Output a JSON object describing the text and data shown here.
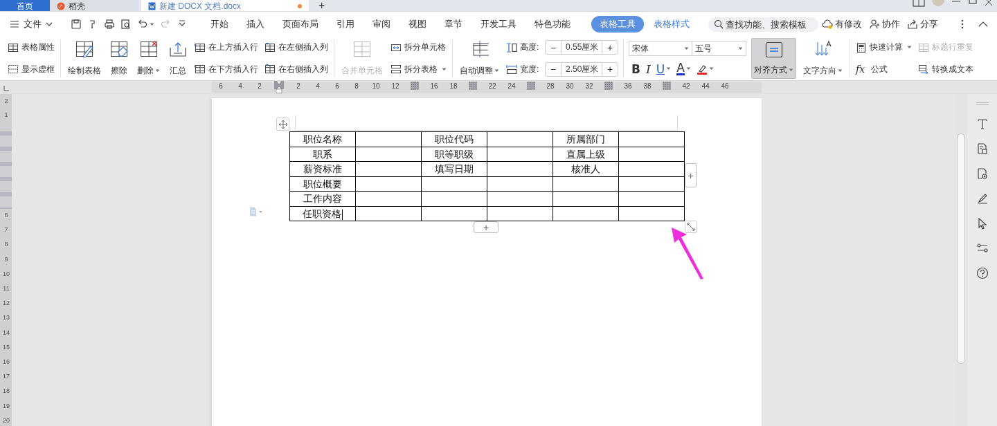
{
  "app_tabs": [
    {
      "label": "首页",
      "kind": "home",
      "selected": false,
      "modified": false
    },
    {
      "label": "稻壳",
      "kind": "docer",
      "selected": false,
      "modified": false
    },
    {
      "label": "新建 DOCX 文档.docx",
      "kind": "document",
      "selected": true,
      "modified": true
    }
  ],
  "new_tab_button": "+",
  "menu_bar": {
    "file_menu": "文件",
    "tabs": [
      {
        "label": "开始",
        "selected": false,
        "contextual": false
      },
      {
        "label": "插入",
        "selected": false,
        "contextual": false
      },
      {
        "label": "页面布局",
        "selected": false,
        "contextual": false
      },
      {
        "label": "引用",
        "selected": false,
        "contextual": false
      },
      {
        "label": "审阅",
        "selected": false,
        "contextual": false
      },
      {
        "label": "视图",
        "selected": false,
        "contextual": false
      },
      {
        "label": "章节",
        "selected": false,
        "contextual": false
      },
      {
        "label": "开发工具",
        "selected": false,
        "contextual": false
      },
      {
        "label": "特色功能",
        "selected": false,
        "contextual": false
      },
      {
        "label": "表格工具",
        "selected": true,
        "contextual": true
      },
      {
        "label": "表格样式",
        "selected": false,
        "contextual": true
      }
    ],
    "search": {
      "placeholder": "查找功能、搜索模板"
    },
    "actions": [
      {
        "label": "有修改"
      },
      {
        "label": "协作"
      },
      {
        "label": "分享"
      }
    ]
  },
  "ribbon": [
    {
      "kind": "stack",
      "items": [
        {
          "label": "表格属性",
          "disabled": false,
          "dropdown": false
        },
        {
          "label": "显示虚框",
          "disabled": false,
          "dropdown": false
        }
      ]
    },
    {
      "kind": "separator"
    },
    {
      "kind": "large",
      "label": "绘制表格",
      "disabled": false,
      "dropdown": false,
      "selected": false
    },
    {
      "kind": "large",
      "label": "擦除",
      "disabled": false,
      "dropdown": false,
      "selected": false
    },
    {
      "kind": "large",
      "label": "删除",
      "disabled": false,
      "dropdown": true,
      "selected": false
    },
    {
      "kind": "large",
      "label": "汇总",
      "disabled": false,
      "dropdown": false,
      "selected": false
    },
    {
      "kind": "stack",
      "items": [
        {
          "label": "在上方插入行",
          "disabled": false,
          "dropdown": false
        },
        {
          "label": "在下方插入行",
          "disabled": false,
          "dropdown": false
        }
      ]
    },
    {
      "kind": "stack",
      "items": [
        {
          "label": "在左侧插入列",
          "disabled": false,
          "dropdown": false
        },
        {
          "label": "在右侧插入列",
          "disabled": false,
          "dropdown": false
        }
      ]
    },
    {
      "kind": "separator"
    },
    {
      "kind": "large",
      "label": "合并单元格",
      "disabled": true,
      "dropdown": false,
      "selected": false
    },
    {
      "kind": "stack",
      "items": [
        {
          "label": "拆分单元格",
          "disabled": false,
          "dropdown": false
        },
        {
          "label": "拆分表格",
          "disabled": false,
          "dropdown": true
        }
      ]
    },
    {
      "kind": "separator"
    },
    {
      "kind": "large",
      "label": "自动调整",
      "disabled": false,
      "dropdown": true,
      "selected": false
    },
    {
      "kind": "spinners",
      "items": [
        {
          "label": "高度:",
          "value": "0.55厘米",
          "minus": "−",
          "plus": "+"
        },
        {
          "label": "宽度:",
          "value": "2.50厘米",
          "minus": "−",
          "plus": "+"
        }
      ]
    },
    {
      "kind": "separator"
    },
    {
      "kind": "font",
      "font": "宋体",
      "size": "五号",
      "buttons": [
        {
          "kind": "bold",
          "label": "B",
          "dropdown": false
        },
        {
          "kind": "italic",
          "label": "I",
          "dropdown": false
        },
        {
          "kind": "underline",
          "label": "U",
          "dropdown": true
        },
        {
          "kind": "font-color",
          "label": "A",
          "dropdown": true,
          "color": "#1a2fc8"
        },
        {
          "kind": "highlight",
          "dropdown": true,
          "color": "#e02828"
        }
      ]
    },
    {
      "kind": "large",
      "label": "对齐方式",
      "disabled": false,
      "dropdown": true,
      "selected": true
    },
    {
      "kind": "large",
      "label": "文字方向",
      "disabled": false,
      "dropdown": true,
      "selected": false
    },
    {
      "kind": "separator"
    },
    {
      "kind": "stack",
      "items": [
        {
          "label": "快速计算",
          "disabled": false,
          "dropdown": true
        },
        {
          "label": "公式",
          "prefix": "fx",
          "disabled": false,
          "dropdown": false
        }
      ]
    },
    {
      "kind": "stack",
      "items": [
        {
          "label": "标题行重复",
          "disabled": true,
          "dropdown": false
        },
        {
          "label": "转换成文本",
          "disabled": false,
          "dropdown": false
        }
      ]
    }
  ],
  "ruler": [
    {
      "kind": "number",
      "label": "6"
    },
    {
      "kind": "number",
      "label": "4"
    },
    {
      "kind": "number",
      "label": "2"
    },
    {
      "kind": "indent"
    },
    {
      "kind": "number",
      "label": "2"
    },
    {
      "kind": "number",
      "label": "4"
    },
    {
      "kind": "number",
      "label": "6"
    },
    {
      "kind": "number",
      "label": "8"
    },
    {
      "kind": "number",
      "label": "10"
    },
    {
      "kind": "number",
      "label": "12"
    },
    {
      "kind": "marker"
    },
    {
      "kind": "number",
      "label": "16"
    },
    {
      "kind": "number",
      "label": "18"
    },
    {
      "kind": "marker"
    },
    {
      "kind": "number",
      "label": "22"
    },
    {
      "kind": "number",
      "label": "24"
    },
    {
      "kind": "marker"
    },
    {
      "kind": "number",
      "label": "28"
    },
    {
      "kind": "number",
      "label": "30"
    },
    {
      "kind": "number",
      "label": "32"
    },
    {
      "kind": "marker"
    },
    {
      "kind": "number",
      "label": "36"
    },
    {
      "kind": "number",
      "label": "38"
    },
    {
      "kind": "marker"
    },
    {
      "kind": "number",
      "label": "42"
    },
    {
      "kind": "number",
      "label": "44"
    },
    {
      "kind": "number",
      "label": "46"
    }
  ],
  "vertical_ruler": [
    "2",
    "1",
    "6",
    "7",
    "8",
    "9",
    "10",
    "11",
    "12",
    "13",
    "14",
    "15",
    "16",
    "17",
    "18",
    "19",
    "20"
  ],
  "table": {
    "rows": [
      {
        "cells": [
          {
            "text": "职位名称",
            "caret": false
          },
          {
            "caret": false
          },
          {
            "text": "职位代码",
            "caret": false
          },
          {
            "caret": false
          },
          {
            "text": "所属部门",
            "caret": false
          },
          {
            "caret": false
          }
        ]
      },
      {
        "cells": [
          {
            "text": "职系",
            "caret": false
          },
          {
            "caret": false
          },
          {
            "text": "职等职级",
            "caret": false
          },
          {
            "caret": false
          },
          {
            "text": "直属上级",
            "caret": false
          },
          {
            "caret": false
          }
        ]
      },
      {
        "cells": [
          {
            "text": "薪资标准",
            "caret": false
          },
          {
            "caret": false
          },
          {
            "text": "填写日期",
            "caret": false
          },
          {
            "caret": false
          },
          {
            "text": "核准人",
            "caret": false
          },
          {
            "caret": false
          }
        ]
      },
      {
        "cells": [
          {
            "text": "职位概要",
            "caret": false
          },
          {
            "caret": false
          },
          {
            "caret": false
          },
          {
            "caret": false
          },
          {
            "caret": false
          },
          {
            "caret": false
          }
        ]
      },
      {
        "cells": [
          {
            "text": "工作内容",
            "caret": false
          },
          {
            "caret": false
          },
          {
            "caret": false
          },
          {
            "caret": false
          },
          {
            "caret": false
          },
          {
            "caret": false
          }
        ]
      },
      {
        "cells": [
          {
            "text": "任职资格",
            "caret": true
          },
          {
            "caret": false
          },
          {
            "caret": false
          },
          {
            "caret": false
          },
          {
            "caret": false
          },
          {
            "caret": false
          }
        ]
      }
    ],
    "add_column_button": "+",
    "add_row_button": "+"
  },
  "annotation_arrow": true
}
